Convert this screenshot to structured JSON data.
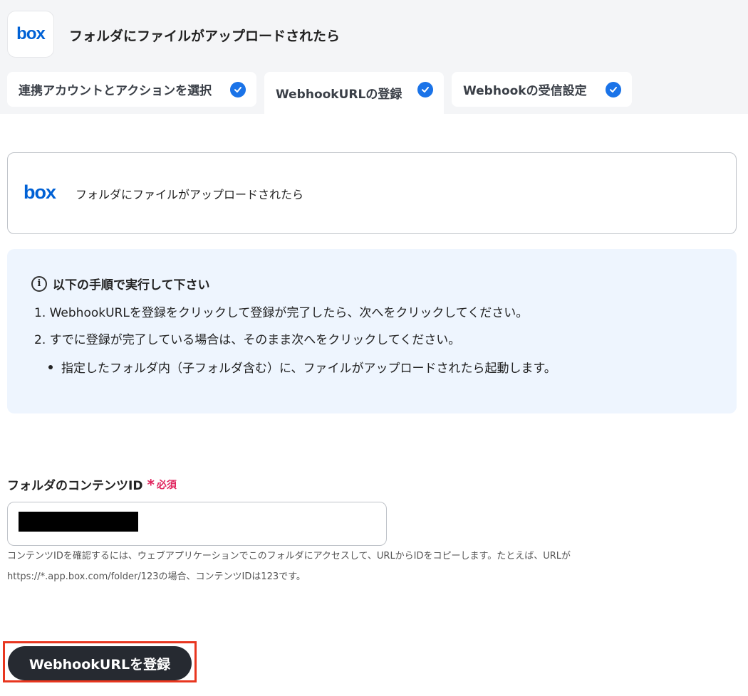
{
  "header": {
    "app_logo_text": "box",
    "title": "フォルダにファイルがアップロードされたら"
  },
  "tabs": [
    {
      "label": "連携アカウントとアクションを選択",
      "completed": true,
      "active": false
    },
    {
      "label": "WebhookURLの登録",
      "completed": true,
      "active": true
    },
    {
      "label": "Webhookの受信設定",
      "completed": true,
      "active": false
    }
  ],
  "trigger": {
    "logo_text": "box",
    "label": "フォルダにファイルがアップロードされたら"
  },
  "instructions": {
    "icon": "info-icon",
    "title": "以下の手順で実行して下さい",
    "step1": "1. WebhookURLを登録をクリックして登録が完了したら、次へをクリックしてください。",
    "step2": "2. すでに登録が完了している場合は、そのまま次へをクリックしてください。",
    "bullet": "指定したフォルダ内（子フォルダ含む）に、ファイルがアップロードされたら起動します。"
  },
  "field": {
    "label": "フォルダのコンテンツID",
    "required_mark": "*",
    "required_label": "必須",
    "help_line1": "コンテンツIDを確認するには、ウェブアプリケーションでこのフォルダにアクセスして、URLからIDをコピーします。たとえば、URLが",
    "help_line2": "https://*.app.box.com/folder/123の場合、コンテンツIDは123です。"
  },
  "actions": {
    "register_label": "WebhookURLを登録"
  },
  "colors": {
    "accent": "#1a73e8",
    "box_brand": "#0061d5",
    "required": "#e0245e",
    "button_bg": "#262a31",
    "highlight": "#e8361f",
    "info_bg": "#eef5fe"
  }
}
